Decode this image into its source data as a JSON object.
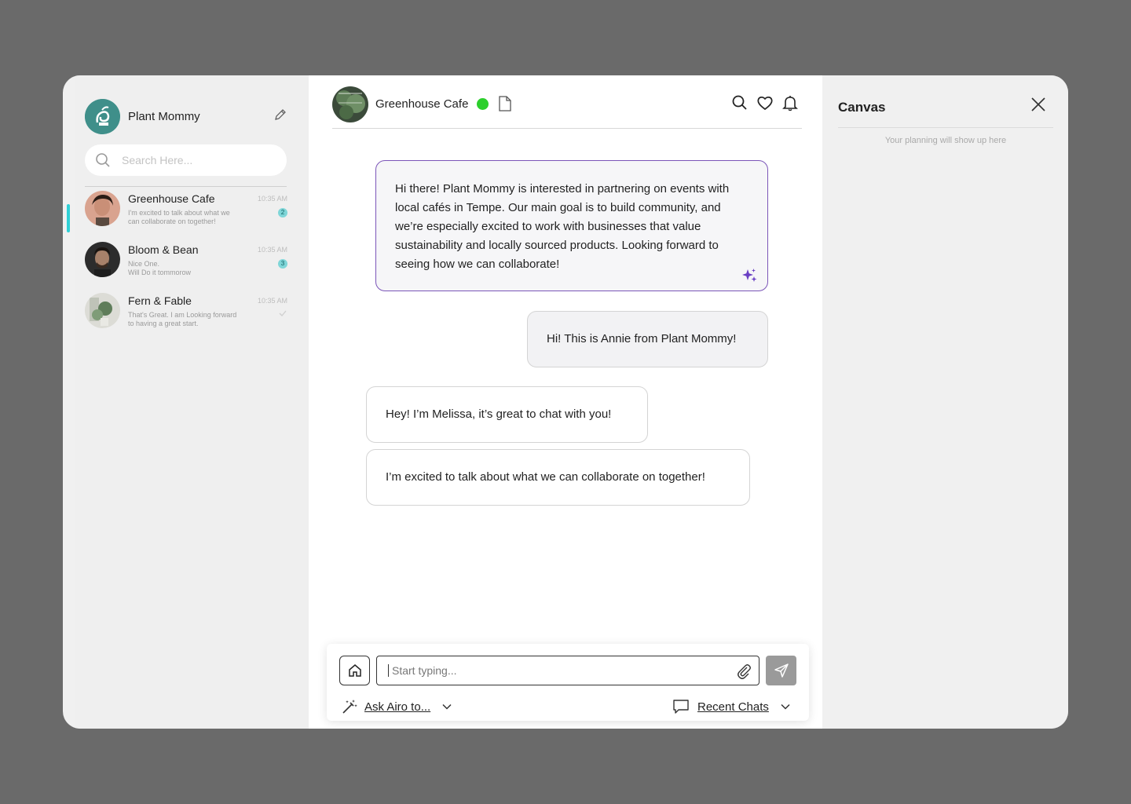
{
  "profile": {
    "name": "Plant Mommy"
  },
  "search": {
    "placeholder": "Search Here..."
  },
  "chats": [
    {
      "name": "Greenhouse Cafe",
      "preview": "I'm excited to talk about what we can collaborate on together!",
      "time": "10:35 AM",
      "badge": "2"
    },
    {
      "name": "Bloom & Bean",
      "preview_line1": "Nice One.",
      "preview_line2": "Will Do it tommorow",
      "time": "10:35 AM",
      "badge": "3"
    },
    {
      "name": "Fern & Fable",
      "preview": "That's Great. I am Looking forward to having a great start.",
      "time": "10:35 AM"
    }
  ],
  "header": {
    "name": "Greenhouse Cafe",
    "status_color": "#2ccf2c"
  },
  "messages": {
    "ai_draft": "Hi there! Plant Mommy is interested in partnering on events with local cafés in Tempe. Our main goal is to build community, and we’re especially excited to work with businesses that value sustainability and locally sourced products. Looking forward to seeing how we can collaborate!",
    "outgoing": "Hi! This is Annie from Plant Mommy!",
    "incoming_1": "Hey! I’m Melissa, it’s great to chat with you!",
    "incoming_2": "I’m excited to talk about what we can collaborate on together!"
  },
  "composer": {
    "placeholder": "Start typing...",
    "ask_label": "Ask Airo to...",
    "recent_label": "Recent Chats"
  },
  "canvas": {
    "title": "Canvas",
    "hint": "Your planning will show up here"
  },
  "colors": {
    "accent": "#2fd0d6",
    "ai_border": "#7b55b8",
    "send": "#9a9a9a"
  }
}
